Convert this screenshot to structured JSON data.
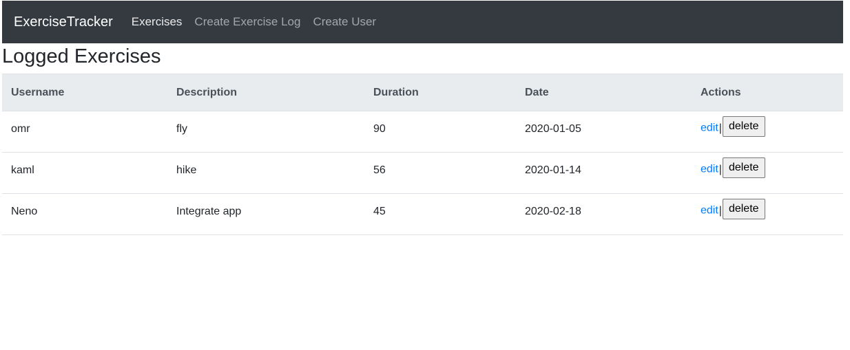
{
  "navbar": {
    "brand": "ExerciseTracker",
    "links": [
      {
        "label": "Exercises",
        "active": true
      },
      {
        "label": "Create Exercise Log",
        "active": false
      },
      {
        "label": "Create User",
        "active": false
      }
    ]
  },
  "page_title": "Logged Exercises",
  "table": {
    "headers": [
      "Username",
      "Description",
      "Duration",
      "Date",
      "Actions"
    ],
    "rows": [
      {
        "username": "omr",
        "description": "fly",
        "duration": "90",
        "date": "2020-01-05",
        "edit": "edit",
        "separator": "|",
        "delete": "delete"
      },
      {
        "username": "kaml",
        "description": "hike",
        "duration": "56",
        "date": "2020-01-14",
        "edit": "edit",
        "separator": "|",
        "delete": "delete"
      },
      {
        "username": "Neno",
        "description": "Integrate app",
        "duration": "45",
        "date": "2020-02-18",
        "edit": "edit",
        "separator": "|",
        "delete": "delete"
      }
    ]
  },
  "colors": {
    "navbar_bg": "#343a40",
    "header_bg": "#e9ecef",
    "link": "#007bff"
  }
}
